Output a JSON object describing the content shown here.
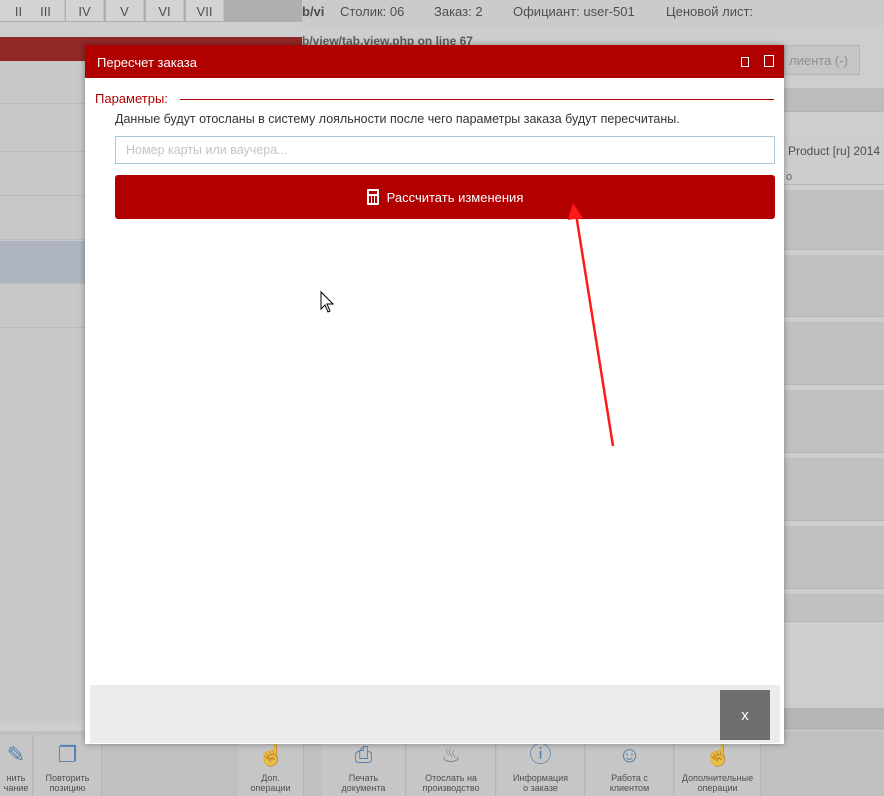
{
  "background": {
    "tabs": [
      "II",
      "III",
      "IV",
      "V",
      "VI",
      "VII"
    ],
    "info_prefix": "b/vi",
    "table_label": "Столик: 06",
    "order_label": "Заказ: 2",
    "waiter_label": "Официант: user-501",
    "pricelist_label": "Ценовой лист:",
    "error_line": "b/view/tab.view.php on line 67",
    "client_tab_label": "лиента (-)",
    "product_text": "Product [ru] 2014",
    "product_sub": "о",
    "bottom_buttons": [
      {
        "label": "нить\nчание",
        "icon": "edit-icon"
      },
      {
        "label": "Повторить\nпозицию",
        "icon": "copy-icon"
      },
      {
        "label": "Доп.\nоперации",
        "icon": "hand-pointer-icon"
      },
      {
        "label": "Печать\nдокумента",
        "icon": "printer-icon"
      },
      {
        "label": "Отослать на\nпроизводство",
        "icon": "chef-hat-icon"
      },
      {
        "label": "Информация\nо заказе",
        "icon": "info-icon"
      },
      {
        "label": "Работа с\nклиентом",
        "icon": "user-icon"
      },
      {
        "label": "Дополнительные\nоперации",
        "icon": "hand-pointer-icon"
      }
    ]
  },
  "modal": {
    "title": "Пересчет заказа",
    "legend": "Параметры:",
    "description": "Данные будут отосланы в систему лояльности после чего параметры заказа будут пересчитаны.",
    "card_input": {
      "value": "",
      "placeholder": "Номер карты или ваучера..."
    },
    "calculate_button": "Рассчитать изменения",
    "close_button": "x"
  },
  "colors": {
    "accent": "#b00000",
    "close_button": "#6f6f6f",
    "arrow": "#ff1a1a"
  }
}
